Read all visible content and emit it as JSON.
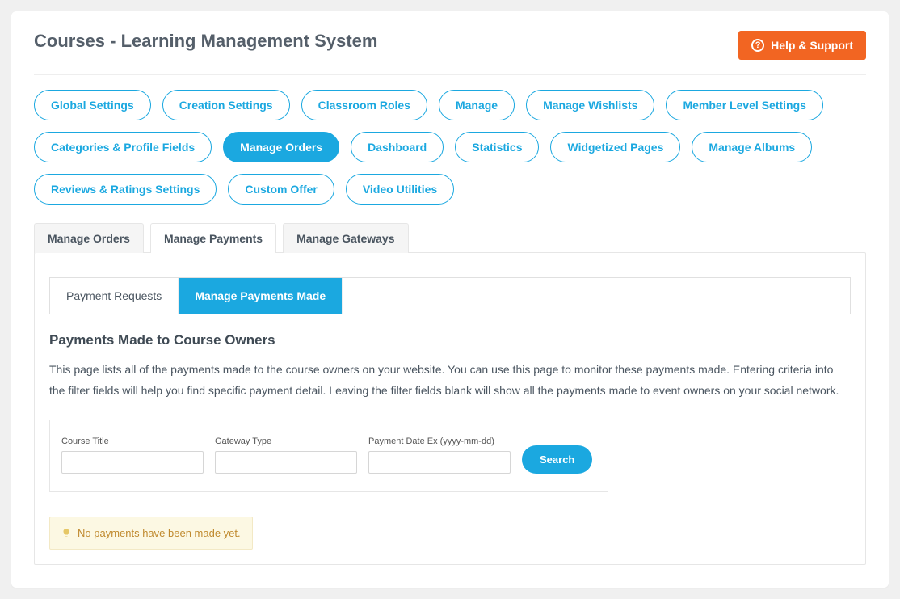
{
  "header": {
    "title": "Courses - Learning Management System",
    "help_label": "Help & Support"
  },
  "nav_pills": [
    {
      "label": "Global Settings",
      "active": false
    },
    {
      "label": "Creation Settings",
      "active": false
    },
    {
      "label": "Classroom Roles",
      "active": false
    },
    {
      "label": "Manage",
      "active": false
    },
    {
      "label": "Manage Wishlists",
      "active": false
    },
    {
      "label": "Member Level Settings",
      "active": false
    },
    {
      "label": "Categories & Profile Fields",
      "active": false
    },
    {
      "label": "Manage Orders",
      "active": true
    },
    {
      "label": "Dashboard",
      "active": false
    },
    {
      "label": "Statistics",
      "active": false
    },
    {
      "label": "Widgetized Pages",
      "active": false
    },
    {
      "label": "Manage Albums",
      "active": false
    },
    {
      "label": "Reviews & Ratings Settings",
      "active": false
    },
    {
      "label": "Custom Offer",
      "active": false
    },
    {
      "label": "Video Utilities",
      "active": false
    }
  ],
  "sub_tabs": [
    {
      "label": "Manage Orders",
      "active": false
    },
    {
      "label": "Manage Payments",
      "active": true
    },
    {
      "label": "Manage Gateways",
      "active": false
    }
  ],
  "inner_tabs": [
    {
      "label": "Payment Requests",
      "active": false
    },
    {
      "label": "Manage Payments Made",
      "active": true
    }
  ],
  "section": {
    "title": "Payments Made to Course Owners",
    "description": "This page lists all of the payments made to the course owners on your website. You can use this page to monitor these payments made. Entering criteria into the filter fields will help you find specific payment detail. Leaving the filter fields blank will show all the payments made to event owners on your social network."
  },
  "filters": {
    "course_title_label": "Course Title",
    "gateway_type_label": "Gateway Type",
    "payment_date_label": "Payment Date Ex (yyyy-mm-dd)",
    "course_title_value": "",
    "gateway_type_value": "",
    "payment_date_value": "",
    "search_label": "Search"
  },
  "notice": {
    "message": "No payments have been made yet."
  }
}
